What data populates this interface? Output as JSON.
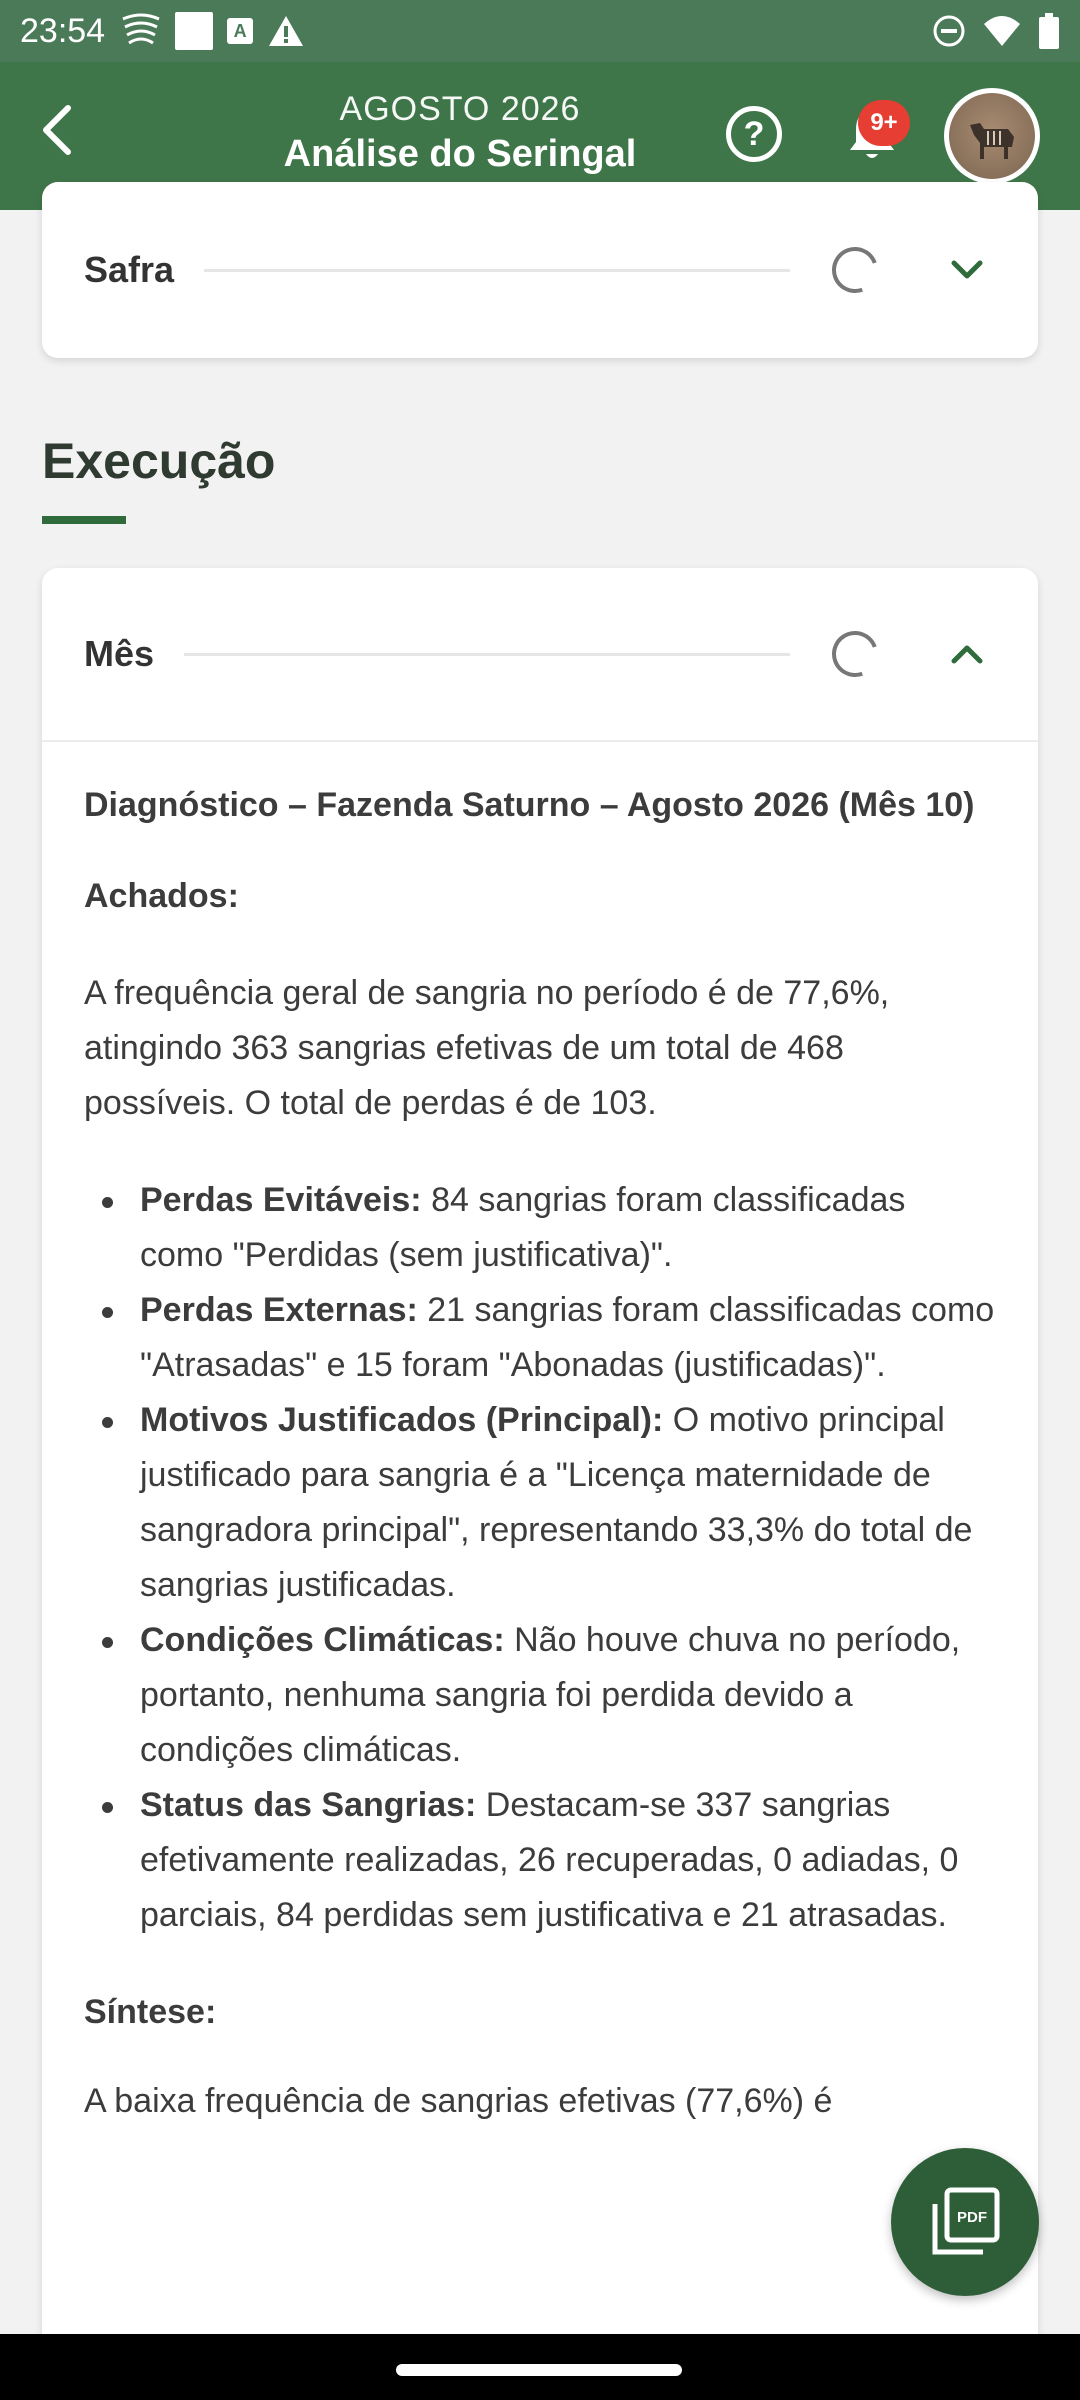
{
  "status_bar": {
    "time": "23:54",
    "icons_left": [
      "wifi-calling-icon",
      "square-icon",
      "a-icon",
      "warning-icon"
    ],
    "icons_right": [
      "dnd-icon",
      "wifi-icon",
      "battery-icon"
    ]
  },
  "header": {
    "subtitle": "AGOSTO 2026",
    "title": "Análise do Seringal",
    "notification_badge": "9+"
  },
  "safra_card": {
    "label": "Safra"
  },
  "section": {
    "title": "Execução"
  },
  "mes_card": {
    "label": "Mês",
    "heading": "Diagnóstico – Fazenda Saturno – Agosto 2026 (Mês 10)",
    "achados_label": "Achados:",
    "intro": "A frequência geral de sangria no período é de 77,6%, atingindo 363 sangrias efetivas de um total de 468 possíveis. O total de perdas é de 103.",
    "bullets": [
      {
        "bold": "Perdas Evitáveis:",
        "text": " 84 sangrias foram classificadas como \"Perdidas (sem justificativa)\"."
      },
      {
        "bold": "Perdas Externas:",
        "text": " 21 sangrias foram classificadas como \"Atrasadas\" e 15 foram \"Abonadas (justificadas)\"."
      },
      {
        "bold": "Motivos Justificados (Principal):",
        "text": " O motivo principal justificado para sangria é a \"Licença maternidade de sangradora principal\", representando 33,3% do total de sangrias justificadas."
      },
      {
        "bold": "Condições Climáticas:",
        "text": " Não houve chuva no período, portanto, nenhuma sangria foi perdida devido a condições climáticas."
      },
      {
        "bold": "Status das Sangrias:",
        "text": " Destacam-se 337 sangrias efetivamente realizadas, 26 recuperadas, 0 adiadas, 0 parciais, 84 perdidas sem justificativa e 21 atrasadas."
      }
    ],
    "sintese_label": "Síntese:",
    "sintese_text": "A baixa frequência de sangrias efetivas (77,6%) é"
  },
  "fab": {
    "label": "PDF"
  }
}
